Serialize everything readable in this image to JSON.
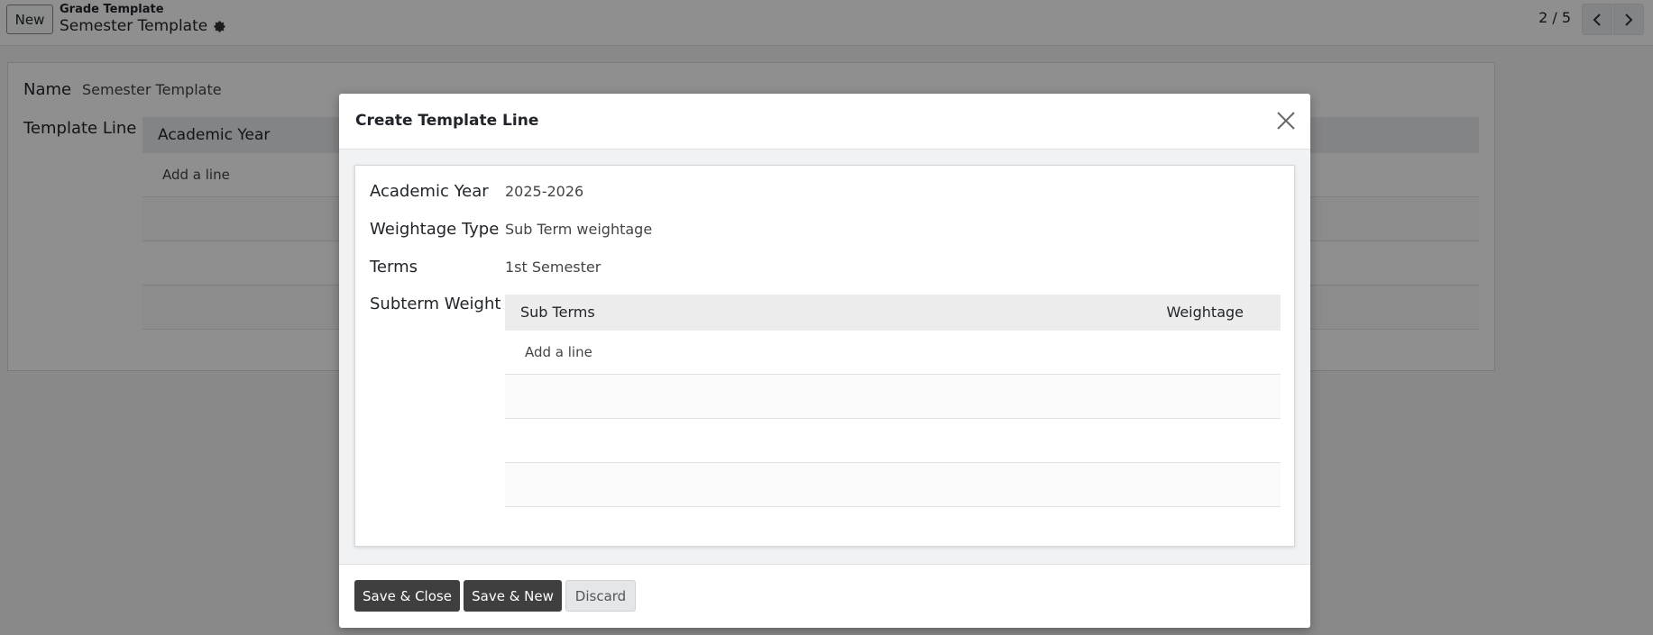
{
  "control_panel": {
    "new_label": "New",
    "breadcrumb_parent": "Grade Template",
    "breadcrumb_current": "Semester Template",
    "pager": "2 / 5"
  },
  "form": {
    "name_label": "Name",
    "name_value": "Semester Template",
    "template_line_label": "Template Line",
    "table_header": "Academic Year",
    "add_line": "Add a line"
  },
  "modal": {
    "title": "Create Template Line",
    "fields": {
      "academic_year_label": "Academic Year",
      "academic_year_value": "2025-2026",
      "weightage_type_label": "Weightage Type",
      "weightage_type_value": "Sub Term weightage",
      "terms_label": "Terms",
      "terms_value": "1st Semester",
      "subterm_weight_label": "Subterm Weight"
    },
    "subterm_table": {
      "columns": [
        "Sub Terms",
        "Weightage"
      ],
      "add_line": "Add a line"
    },
    "buttons": {
      "save_close": "Save & Close",
      "save_new": "Save & New",
      "discard": "Discard"
    }
  },
  "colors": {
    "dark_button": "#3f3f3f",
    "overlay": "rgba(0,0,0,0.44)"
  }
}
